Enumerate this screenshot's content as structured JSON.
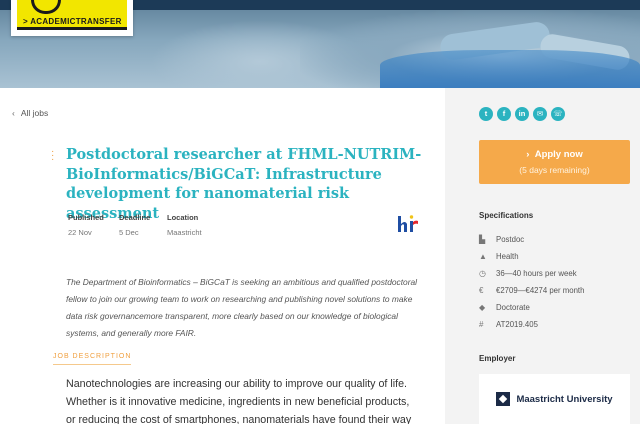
{
  "brand": {
    "logo_text": "> ACADEMICTRANSFER"
  },
  "nav": {
    "back_label": "All jobs"
  },
  "job": {
    "title": "Postdoctoral researcher at FHML-NUTRIM-BioInformatics/BiGCaT: Infrastructure development for nanomaterial risk assessment",
    "meta": [
      {
        "label": "Published",
        "value": "22 Nov"
      },
      {
        "label": "Deadline",
        "value": "5 Dec"
      },
      {
        "label": "Location",
        "value": "Maastricht"
      }
    ],
    "hr_badge": "hr",
    "intro": "The Department of Bioinformatics – BiGCaT is seeking an ambitious and qualified postdoctoral fellow to join our growing team to work on researching and publishing novel solutions to make data risk governancemore transparent, more clearly based on our knowledge of biological systems, and generally more FAIR.",
    "section_label": "JOB DESCRIPTION",
    "description": "Nanotechnologies are increasing our ability to improve our quality of life. Whether is it innovative medicine, ingredients in new beneficial products, or reducing the cost of smartphones, nanomaterials have found their way"
  },
  "sidebar": {
    "share_icons": [
      "twitter-icon",
      "facebook-icon",
      "linkedin-icon",
      "email-icon",
      "whatsapp-icon"
    ],
    "apply": {
      "label": "Apply now",
      "remaining": "(5 days remaining)"
    },
    "specifications_title": "Specifications",
    "specifications": [
      {
        "icon": "building-icon",
        "text": "Postdoc"
      },
      {
        "icon": "flask-icon",
        "text": "Health"
      },
      {
        "icon": "clock-icon",
        "text": "36—40 hours per week"
      },
      {
        "icon": "euro-icon",
        "text": "€2709—€4274 per month"
      },
      {
        "icon": "graduation-cap-icon",
        "text": "Doctorate"
      },
      {
        "icon": "hash-icon",
        "text": "AT2019.405"
      }
    ],
    "employer_title": "Employer",
    "employer_name": "Maastricht University"
  },
  "colors": {
    "accent": "#2bb3c0",
    "apply": "#f5a94a",
    "brand_yellow": "#f2e600"
  }
}
